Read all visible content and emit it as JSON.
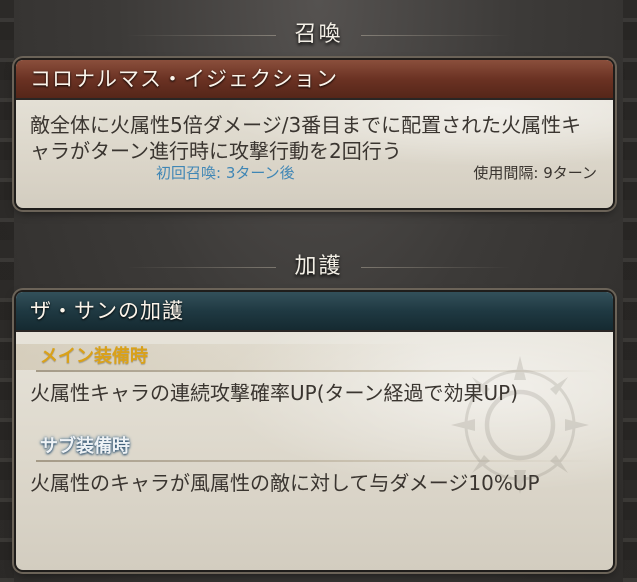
{
  "sections": {
    "summon_title": "召喚",
    "aura_title": "加護"
  },
  "summon": {
    "name": "コロナルマス・イジェクション",
    "description": "敵全体に火属性5倍ダメージ/3番目までに配置された火属性キャラがターン進行時に攻撃行動を2回行う",
    "first_summon": "初回召喚: 3ターン後",
    "cooldown": "使用間隔: 9ターン"
  },
  "aura": {
    "name": "ザ・サンの加護",
    "main_label": "メイン装備時",
    "main_text": "火属性キャラの連続攻撃確率UP(ターン経過で効果UP)",
    "sub_label": "サブ装備時",
    "sub_text": "火属性のキャラが風属性の敵に対して与ダメージ10%UP"
  },
  "colors": {
    "summon_header": "#6b3223",
    "aura_header": "#1f3942",
    "main_label": "#d9a11a",
    "first_summon_text": "#3f86b5"
  }
}
